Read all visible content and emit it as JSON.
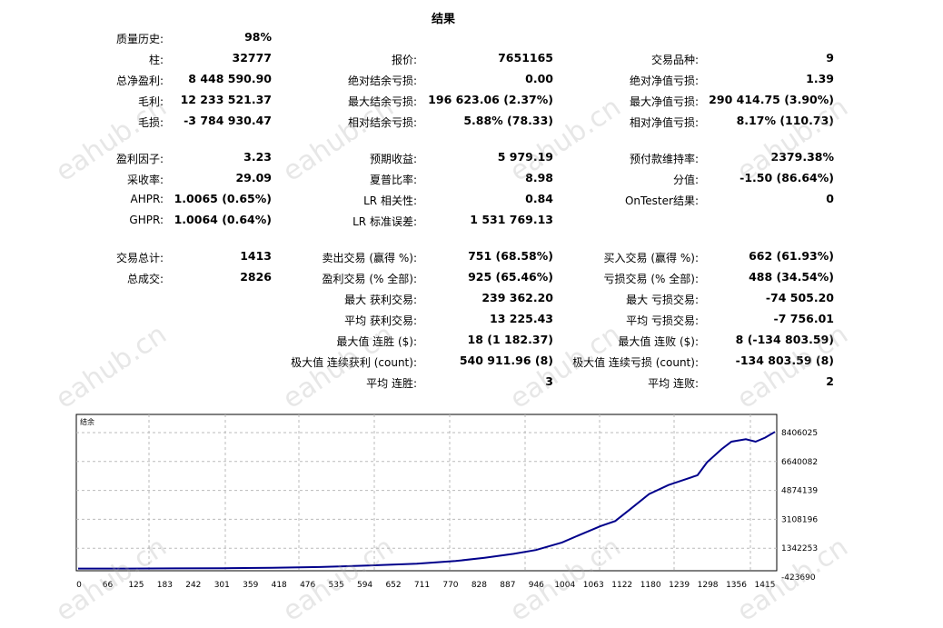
{
  "report": {
    "title": "结果",
    "rows": [
      {
        "top": 1,
        "cells": [
          {
            "col": 1,
            "label": "质量历史:",
            "value": "98%"
          }
        ]
      },
      {
        "top": 2,
        "cells": [
          {
            "col": 1,
            "label": "柱:",
            "value": "32777"
          },
          {
            "col": 2,
            "label": "报价:",
            "value": "7651165"
          },
          {
            "col": 3,
            "label": "交易品种:",
            "value": "9"
          }
        ]
      },
      {
        "top": 3,
        "cells": [
          {
            "col": 1,
            "label": "总净盈利:",
            "value": "8 448 590.90"
          },
          {
            "col": 2,
            "label": "绝对结余亏损:",
            "value": "0.00"
          },
          {
            "col": 3,
            "label": "绝对净值亏损:",
            "value": "1.39"
          }
        ]
      },
      {
        "top": 4,
        "cells": [
          {
            "col": 1,
            "label": "毛利:",
            "value": "12 233 521.37"
          },
          {
            "col": 2,
            "label": "最大结余亏损:",
            "value": "196 623.06 (2.37%)"
          },
          {
            "col": 3,
            "label": "最大净值亏损:",
            "value": "290 414.75 (3.90%)"
          }
        ]
      },
      {
        "top": 5,
        "cells": [
          {
            "col": 1,
            "label": "毛损:",
            "value": "-3 784 930.47"
          },
          {
            "col": 2,
            "label": "相对结余亏损:",
            "value": "5.88% (78.33)"
          },
          {
            "col": 3,
            "label": "相对净值亏损:",
            "value": "8.17% (110.73)"
          }
        ]
      }
    ],
    "section2": [
      {
        "cells": [
          {
            "col": 1,
            "label": "盈利因子:",
            "value": "3.23"
          },
          {
            "col": 2,
            "label": "预期收益:",
            "value": "5 979.19"
          },
          {
            "col": 3,
            "label": "预付款维持率:",
            "value": "2379.38%"
          }
        ]
      },
      {
        "cells": [
          {
            "col": 1,
            "label": "采收率:",
            "value": "29.09"
          },
          {
            "col": 2,
            "label": "夏普比率:",
            "value": "8.98"
          },
          {
            "col": 3,
            "label": "分值:",
            "value": "-1.50 (86.64%)"
          }
        ]
      },
      {
        "cells": [
          {
            "col": 1,
            "label": "AHPR:",
            "value": "1.0065 (0.65%)"
          },
          {
            "col": 2,
            "label": "LR 相关性:",
            "value": "0.84"
          },
          {
            "col": 3,
            "label": "OnTester结果:",
            "value": "0"
          }
        ]
      },
      {
        "cells": [
          {
            "col": 1,
            "label": "GHPR:",
            "value": "1.0064 (0.64%)"
          },
          {
            "col": 2,
            "label": "LR 标准误差:",
            "value": "1 531 769.13"
          }
        ]
      }
    ],
    "section3": [
      {
        "cells": [
          {
            "col": 1,
            "label": "交易总计:",
            "value": "1413"
          },
          {
            "col": 2,
            "label": "卖出交易 (赢得 %):",
            "value": "751 (68.58%)"
          },
          {
            "col": 3,
            "label": "买入交易 (赢得 %):",
            "value": "662 (61.93%)"
          }
        ]
      },
      {
        "cells": [
          {
            "col": 1,
            "label": "总成交:",
            "value": "2826"
          },
          {
            "col": 2,
            "label": "盈利交易 (% 全部):",
            "value": "925 (65.46%)"
          },
          {
            "col": 3,
            "label": "亏损交易 (% 全部):",
            "value": "488 (34.54%)"
          }
        ]
      },
      {
        "cells": [
          {
            "col": 2,
            "label": "最大 获利交易:",
            "value": "239 362.20"
          },
          {
            "col": 3,
            "label": "最大 亏损交易:",
            "value": "-74 505.20"
          }
        ]
      },
      {
        "cells": [
          {
            "col": 2,
            "label": "平均 获利交易:",
            "value": "13 225.43"
          },
          {
            "col": 3,
            "label": "平均 亏损交易:",
            "value": "-7 756.01"
          }
        ]
      },
      {
        "cells": [
          {
            "col": 2,
            "label": "最大值 连胜 ($):",
            "value": "18 (1 182.37)"
          },
          {
            "col": 3,
            "label": "最大值 连败 ($):",
            "value": "8 (-134 803.59)"
          }
        ]
      },
      {
        "cells": [
          {
            "col": 2,
            "label": "极大值 连续获利 (count):",
            "value": "540 911.96 (8)"
          },
          {
            "col": 3,
            "label": "极大值 连续亏损 (count):",
            "value": "-134 803.59 (8)"
          }
        ]
      },
      {
        "cells": [
          {
            "col": 2,
            "label": "平均 连胜:",
            "value": "3"
          },
          {
            "col": 3,
            "label": "平均 连败:",
            "value": "2"
          }
        ]
      }
    ]
  },
  "watermark_text": "eahub.cn",
  "chart_data": {
    "type": "line",
    "legend": "结余",
    "x_ticks": [
      "0",
      "66",
      "125",
      "183",
      "242",
      "301",
      "359",
      "418",
      "476",
      "535",
      "594",
      "652",
      "711",
      "770",
      "828",
      "887",
      "946",
      "1004",
      "1063",
      "1122",
      "1180",
      "1239",
      "1298",
      "1356",
      "1415"
    ],
    "y_ticks": [
      "8406025",
      "6640082",
      "4874139",
      "3108196",
      "1342253",
      "-423690"
    ],
    "ylim": [
      -423690,
      8406025
    ],
    "xlim": [
      0,
      1440
    ],
    "series": [
      {
        "color": "#00008b",
        "points": [
          [
            0,
            100000
          ],
          [
            100,
            100000
          ],
          [
            200,
            110000
          ],
          [
            300,
            120000
          ],
          [
            400,
            140000
          ],
          [
            500,
            190000
          ],
          [
            600,
            280000
          ],
          [
            700,
            400000
          ],
          [
            780,
            560000
          ],
          [
            840,
            760000
          ],
          [
            900,
            1000000
          ],
          [
            946,
            1230000
          ],
          [
            1000,
            1690000
          ],
          [
            1040,
            2200000
          ],
          [
            1080,
            2700000
          ],
          [
            1110,
            3000000
          ],
          [
            1140,
            3700000
          ],
          [
            1180,
            4650000
          ],
          [
            1220,
            5200000
          ],
          [
            1250,
            5500000
          ],
          [
            1280,
            5800000
          ],
          [
            1300,
            6600000
          ],
          [
            1330,
            7400000
          ],
          [
            1350,
            7850000
          ],
          [
            1380,
            8000000
          ],
          [
            1400,
            7850000
          ],
          [
            1420,
            8100000
          ],
          [
            1440,
            8450000
          ]
        ]
      }
    ]
  }
}
